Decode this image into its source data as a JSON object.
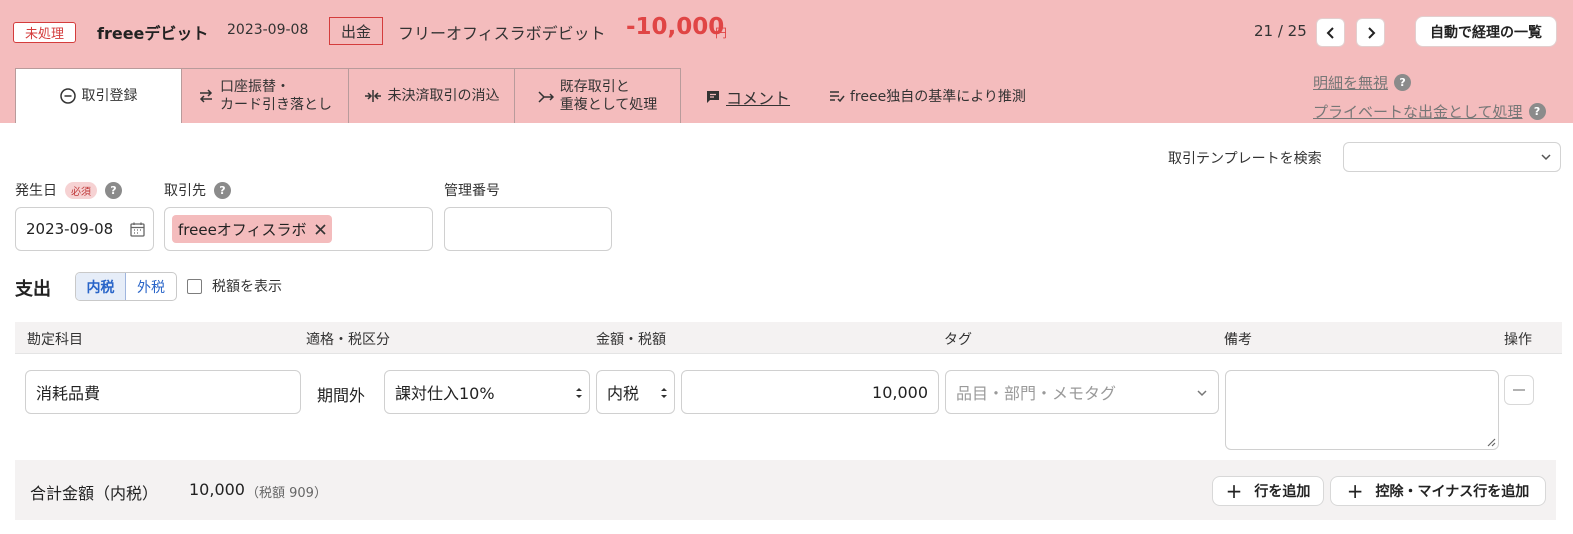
{
  "header": {
    "status": "未処理",
    "bank_name": "freeeデビット",
    "date": "2023-09-08",
    "type": "出金",
    "description": "フリーオフィスラボデビット",
    "amount": "-10,000",
    "currency": "円",
    "pager": "21 / 25",
    "list_button": "自動で経理の一覧"
  },
  "tabs": [
    {
      "label": "取引登録",
      "icon": "minus-circle-icon",
      "active": true
    },
    {
      "label": "口座振替・\nカード引き落とし",
      "icon": "transfer-arrows-icon"
    },
    {
      "label": "未決済取引の消込",
      "icon": "settle-icon"
    },
    {
      "label": "既存取引と\n重複として処理",
      "icon": "merge-arrow-icon"
    }
  ],
  "comment": "コメント",
  "guess": "freee独自の基準により推測",
  "side_links": {
    "ignore": "明細を無視",
    "private": "プライベートな出金として処理"
  },
  "template": {
    "label": "取引テンプレートを検索",
    "value": ""
  },
  "form": {
    "date_label": "発生日",
    "required": "必須",
    "date_value": "2023-09-08",
    "partner_label": "取引先",
    "partner_value": "freeeオフィスラボ",
    "mgmt_label": "管理番号",
    "mgmt_value": ""
  },
  "section": {
    "title": "支出",
    "tax_inclusive": "内税",
    "tax_exclusive": "外税",
    "show_tax": "税額を表示"
  },
  "table": {
    "headers": [
      "勘定科目",
      "適格・税区分",
      "金額・税額",
      "タグ",
      "備考",
      "操作"
    ],
    "row": {
      "account": "消耗品費",
      "qualification": "期間外",
      "tax_category": "課対仕入10%",
      "tax_mode": "内税",
      "amount": "10,000",
      "tag_placeholder": "品目・部門・メモタグ",
      "memo": ""
    }
  },
  "footer": {
    "total_label": "合計金額（内税）",
    "total_value": "10,000",
    "tax_note": "（税額 909）",
    "add_row": "行を追加",
    "add_deduction": "控除・マイナス行を追加"
  },
  "colors": {
    "header_bg": "#f4bcbd",
    "accent_red": "#e04545",
    "link_blue": "#2864c8"
  }
}
